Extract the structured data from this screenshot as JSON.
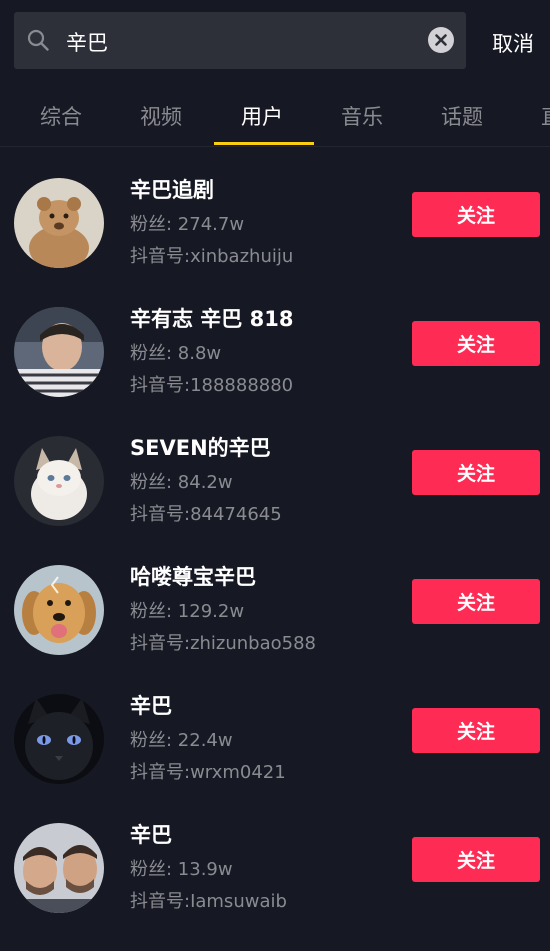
{
  "search": {
    "value": "辛巴",
    "cancel_label": "取消"
  },
  "tabs": [
    {
      "label": "综合"
    },
    {
      "label": "视频"
    },
    {
      "label": "用户"
    },
    {
      "label": "音乐"
    },
    {
      "label": "话题"
    },
    {
      "label": "直"
    }
  ],
  "active_tab": "用户",
  "colors": {
    "background": "#161823",
    "search_bg": "#2e3039",
    "accent_follow": "#fe2c55",
    "tab_indicator": "#face15",
    "muted_text": "#8a8b91"
  },
  "users": [
    {
      "name": "辛巴追剧",
      "fans": "粉丝: 274.7w",
      "douyin_id": "抖音号:xinbazhuiju",
      "follow_label": "关注",
      "avatar": "lion-cub-avatar"
    },
    {
      "name": "辛有志 辛巴 818",
      "fans": "粉丝: 8.8w",
      "douyin_id": "抖音号:188888880",
      "follow_label": "关注",
      "avatar": "man-portrait-avatar"
    },
    {
      "name": "SEVEN的辛巴",
      "fans": "粉丝: 84.2w",
      "douyin_id": "抖音号:84474645",
      "follow_label": "关注",
      "avatar": "white-cat-avatar"
    },
    {
      "name": "哈喽尊宝辛巴",
      "fans": "粉丝: 129.2w",
      "douyin_id": "抖音号:zhizunbao588",
      "follow_label": "关注",
      "avatar": "golden-retriever-avatar"
    },
    {
      "name": "辛巴",
      "fans": "粉丝: 22.4w",
      "douyin_id": "抖音号:wrxm0421",
      "follow_label": "关注",
      "avatar": "black-cat-avatar"
    },
    {
      "name": "辛巴",
      "fans": "粉丝: 13.9w",
      "douyin_id": "抖音号:Iamsuwaib",
      "follow_label": "关注",
      "avatar": "two-men-avatar"
    }
  ]
}
